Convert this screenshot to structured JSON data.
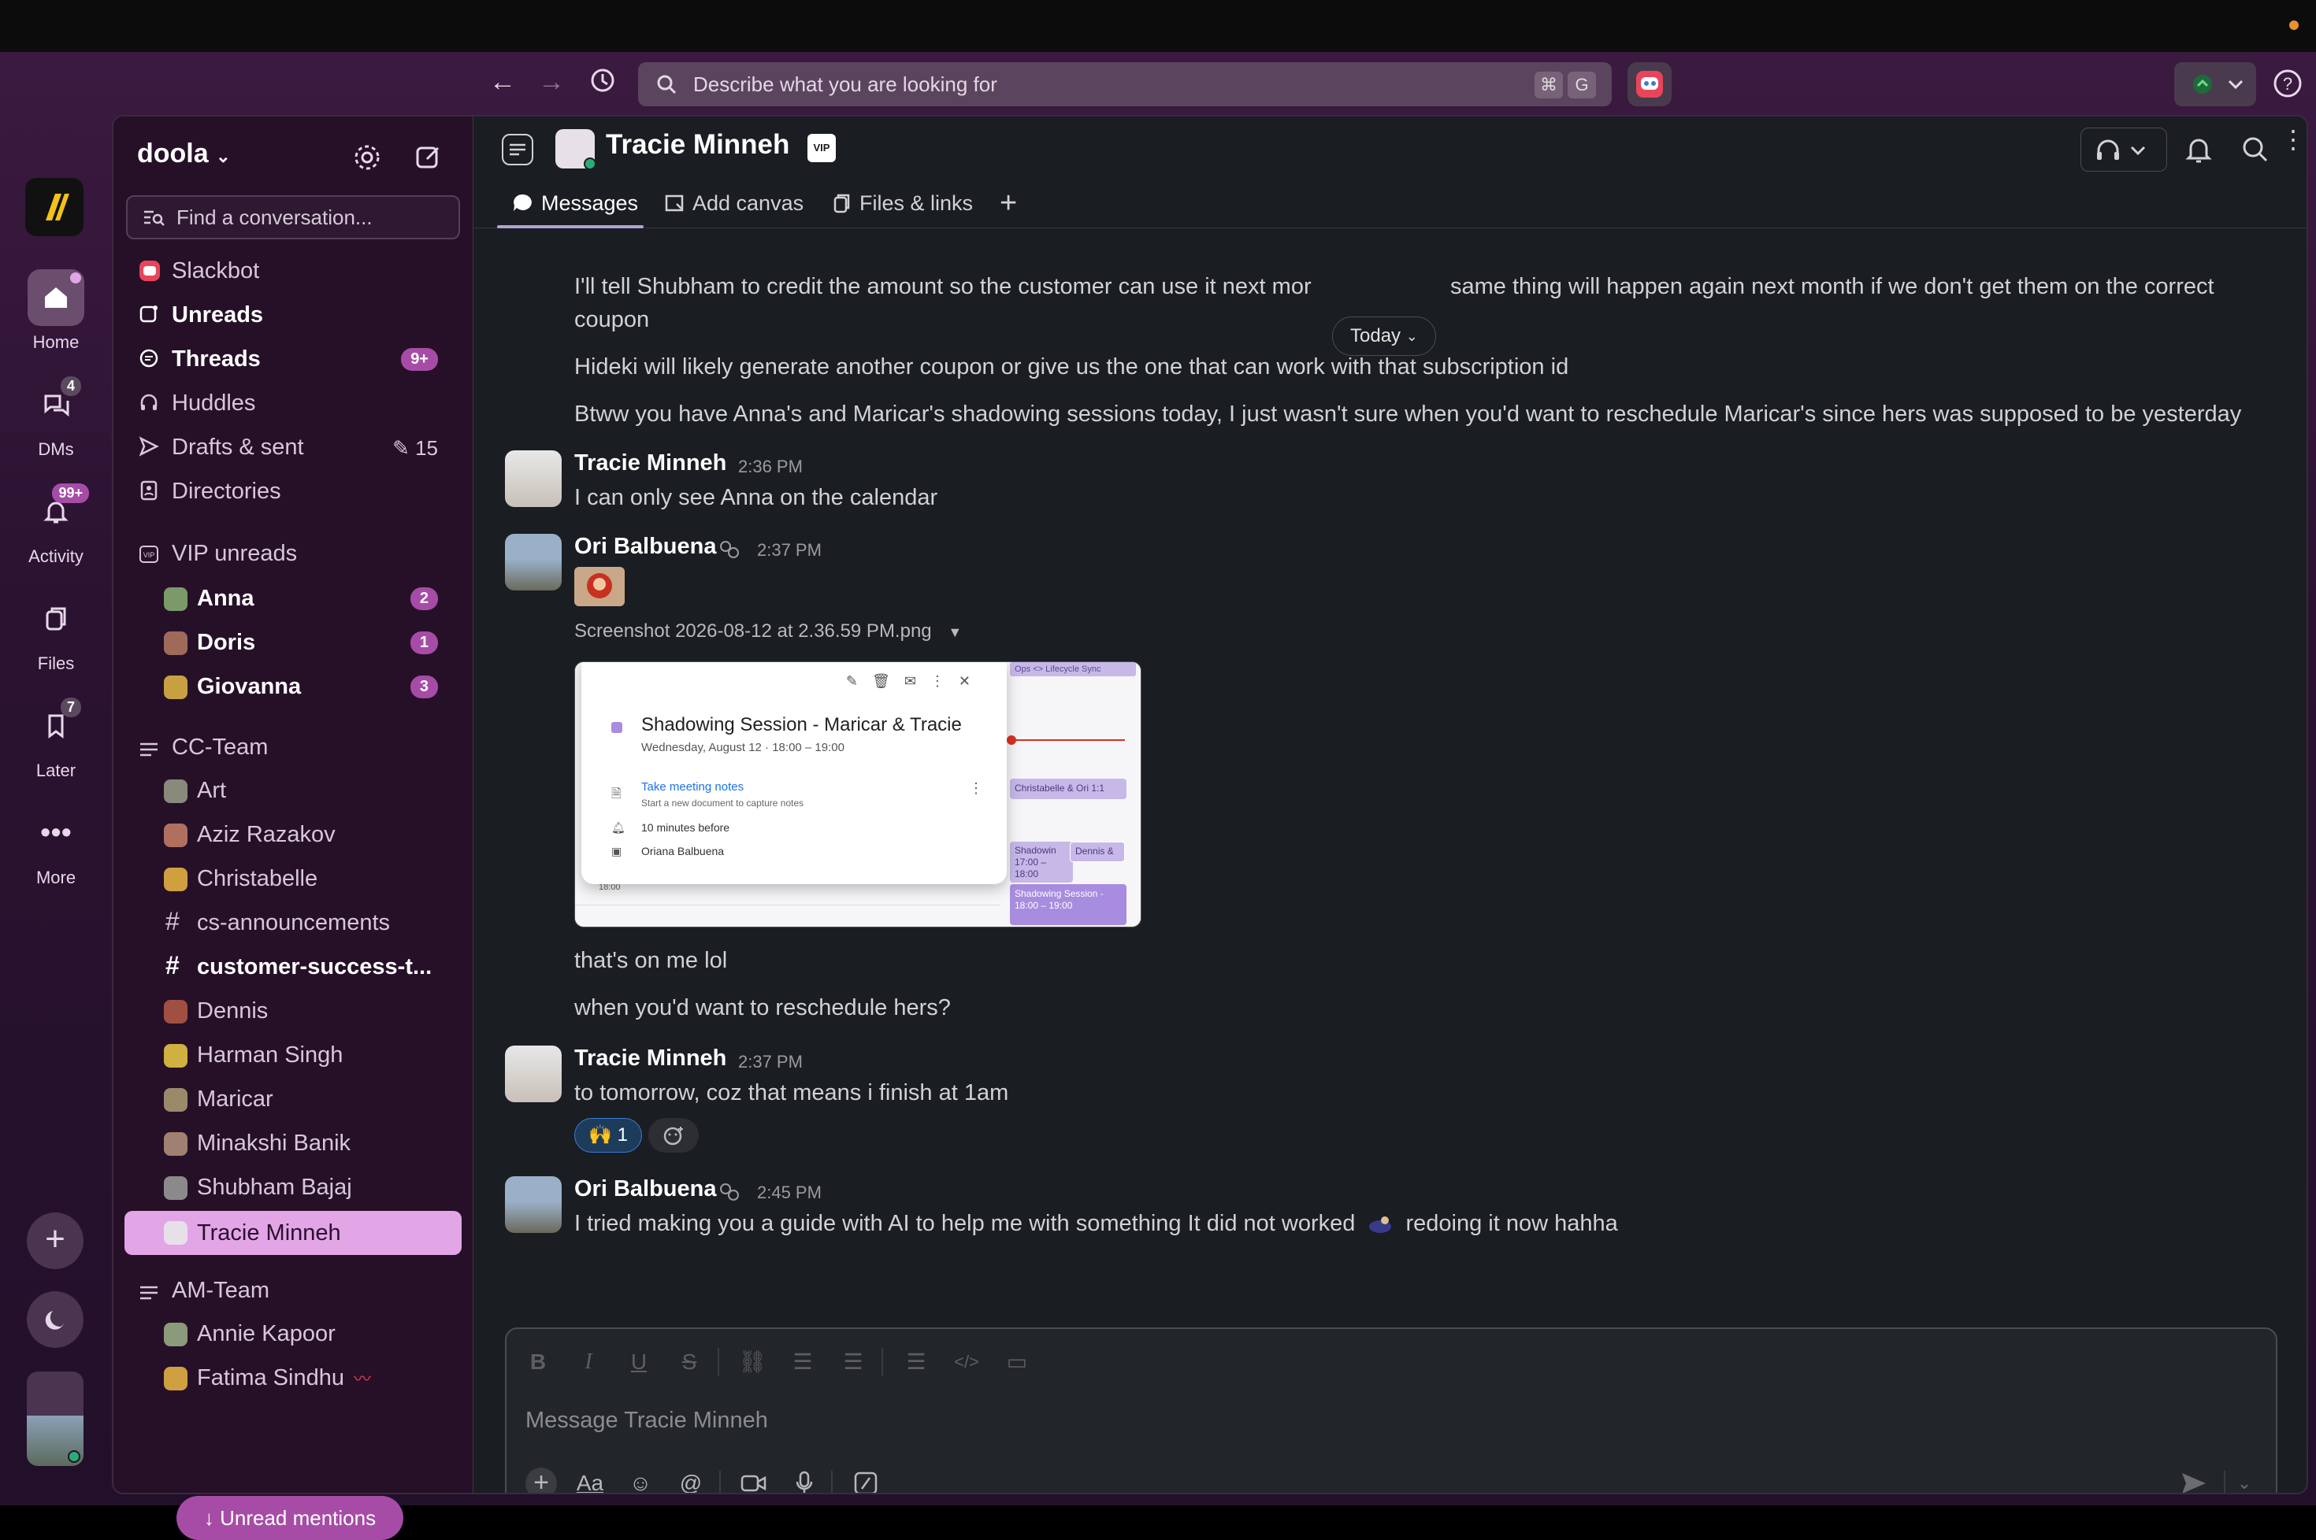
{
  "search": {
    "placeholder": "Describe what you are looking for",
    "kbd1": "⌘",
    "kbd2": "G"
  },
  "rail": {
    "home_label": "Home",
    "dms_label": "DMs",
    "dms_badge": "4",
    "activity_label": "Activity",
    "activity_badge": "99+",
    "files_label": "Files",
    "later_label": "Later",
    "later_badge": "7",
    "more_label": "More"
  },
  "workspace": {
    "name": "doola"
  },
  "sidebar": {
    "find_placeholder": "Find a conversation...",
    "nav": [
      {
        "label": "Slackbot"
      },
      {
        "label": "Unreads"
      },
      {
        "label": "Threads",
        "badge": "9+"
      },
      {
        "label": "Huddles"
      },
      {
        "label": "Drafts & sent",
        "count": "15"
      },
      {
        "label": "Directories"
      }
    ],
    "vip": {
      "header": "VIP unreads",
      "items": [
        {
          "label": "Anna",
          "badge": "2"
        },
        {
          "label": "Doris",
          "badge": "1"
        },
        {
          "label": "Giovanna",
          "badge": "3"
        }
      ]
    },
    "cc_team": {
      "header": "CC-Team",
      "items": [
        {
          "label": "Art"
        },
        {
          "label": "Aziz Razakov"
        },
        {
          "label": "Christabelle"
        },
        {
          "label": "cs-announcements"
        },
        {
          "label": "customer-success-t..."
        },
        {
          "label": "Dennis"
        },
        {
          "label": "Harman Singh"
        },
        {
          "label": "Maricar"
        },
        {
          "label": "Minakshi Banik"
        },
        {
          "label": "Shubham Bajaj"
        },
        {
          "label": "Tracie Minneh"
        }
      ]
    },
    "am_team": {
      "header": "AM-Team",
      "items": [
        {
          "label": "Annie Kapoor"
        },
        {
          "label": "Fatima Sindhu"
        }
      ]
    },
    "unread_mentions": "Unread mentions"
  },
  "channel": {
    "title": "Tracie Minneh",
    "vip_tag": "VIP",
    "tabs": [
      "Messages",
      "Add canvas",
      "Files & links"
    ]
  },
  "messages": {
    "today_label": "Today",
    "line1a": "I'll tell Shubham to credit the amount so the customer can use it next mor",
    "line1b": "same thing will happen again next month if we don't get them on the correct",
    "line1c": "coupon",
    "line2": "Hideki will likely generate another coupon or give us the one that can work with that subscription id",
    "line3": "Btww you have Anna's and Maricar's shadowing sessions today, I just wasn't sure when you'd want to reschedule Maricar's since hers was supposed to be yesterday",
    "m1_author": "Tracie Minneh",
    "m1_time": "2:36 PM",
    "m1_text": "I can only see Anna on the calendar",
    "m2_author": "Ori Balbuena",
    "m2_time": "2:37 PM",
    "m2_file": "Screenshot 2026-08-12 at 2.36.59 PM.png",
    "m2_text1": "that's on me lol",
    "m2_text2": "when you'd want to reschedule hers?",
    "m3_author": "Tracie Minneh",
    "m3_time": "2:37 PM",
    "m3_text": "to tomorrow, coz that means i finish at 1am",
    "m3_reaction": "🙌 1",
    "m4_author": "Ori Balbuena",
    "m4_time": "2:45 PM",
    "m4_text_a": "I tried making you a guide with AI to help me with something It did not worked",
    "m4_text_b": "redoing it now hahha"
  },
  "attachment": {
    "event_title": "Shadowing Session - Maricar & Tracie",
    "event_date": "Wednesday, August 12  ·  18:00 – 19:00",
    "notes_link": "Take meeting notes",
    "notes_sub": "Start a new document to capture notes",
    "reminder": "10 minutes before",
    "organizer": "Oriana Balbuena",
    "cal_a": "Ops <> Lifecycle Sync",
    "cal_b": "Christabelle & Ori 1:1",
    "cal_c": "Shadowin",
    "cal_c2": "17:00 – 18:00",
    "cal_d": "Dennis &",
    "cal_e": "Shadowing Session -",
    "cal_e2": "18:00 – 19:00",
    "cal_time": "18:00"
  },
  "composer": {
    "placeholder": "Message Tracie Minneh"
  },
  "colors": {
    "accent": "#a64ca6",
    "active_item": "#e2a5e6",
    "main_bg": "#1a1d21"
  }
}
